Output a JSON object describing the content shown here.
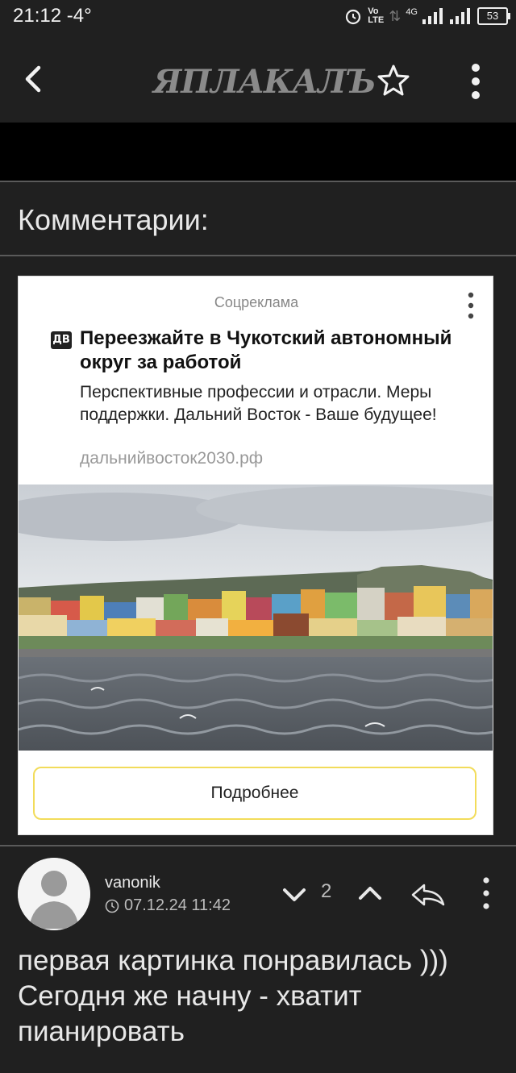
{
  "status_bar": {
    "time": "21:12",
    "temperature": "-4°",
    "battery": "53",
    "network": "4G"
  },
  "header": {
    "logo_text": "ЯПЛАКАЛЪ",
    "icons": [
      "back-arrow-icon",
      "star-icon",
      "more-vertical-icon"
    ]
  },
  "comments_section": {
    "title": "Комментарии:"
  },
  "ad": {
    "label": "Соцреклама",
    "logo_text": "ДВ",
    "title": "Переезжайте в Чукотский автономный округ за работой",
    "description": "Перспективные профессии и отрасли. Меры поддержки. Дальний Восток - Ваше будущее!",
    "domain": "дальнийвосток2030.рф",
    "button_label": "Подробнее"
  },
  "comment": {
    "username": "vanonik",
    "date": "07.12.24 11:42",
    "vote_count": "2",
    "text": "первая картинка понравилась ))) Сегодня же начну - хватит пианировать"
  },
  "colors": {
    "background": "#202020",
    "ad_button_border": "#f2dc5a"
  }
}
